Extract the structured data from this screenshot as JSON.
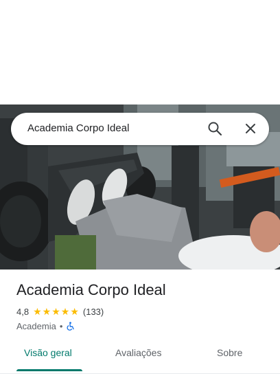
{
  "search": {
    "query": "Academia Corpo Ideal"
  },
  "place": {
    "title": "Academia Corpo Ideal",
    "rating": "4,8",
    "stars": 5,
    "review_count": "(133)",
    "category": "Academia",
    "separator": "•"
  },
  "tabs": [
    {
      "label": "Visão geral",
      "active": true
    },
    {
      "label": "Avaliações",
      "active": false
    },
    {
      "label": "Sobre",
      "active": false
    }
  ],
  "colors": {
    "accent": "#00796b",
    "star": "#fbbc04",
    "accessibility": "#1a73e8"
  },
  "icons": {
    "search": "search-icon",
    "close": "close-icon",
    "accessibility": "wheelchair-icon"
  }
}
